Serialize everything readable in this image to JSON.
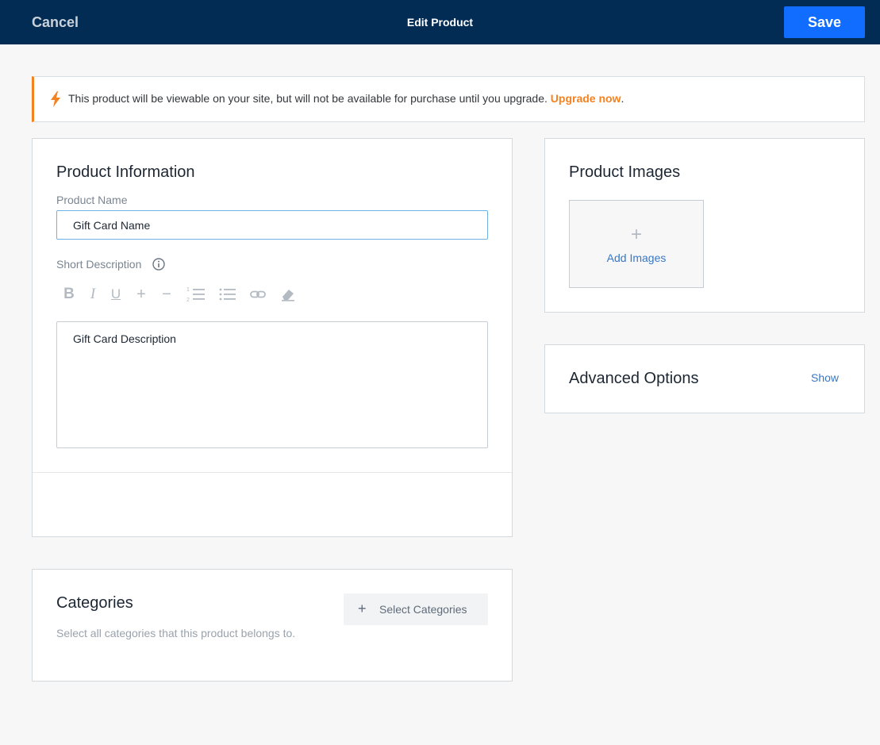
{
  "header": {
    "cancel_label": "Cancel",
    "title": "Edit Product",
    "save_label": "Save"
  },
  "banner": {
    "icon": "lightning-bolt-icon",
    "message": "This product will be viewable on your site, but will not be available for purchase until you upgrade. ",
    "link_label": "Upgrade now",
    "suffix": ".",
    "accent_color": "#f58220"
  },
  "product_info": {
    "title": "Product Information",
    "name_label": "Product Name",
    "name_value": "Gift Card Name",
    "description_label": "Short Description",
    "description_value": "Gift Card Description",
    "toolbar": [
      "bold-icon",
      "italic-icon",
      "underline-icon",
      "increase-font-icon",
      "decrease-font-icon",
      "numbered-list-icon",
      "bulleted-list-icon",
      "link-icon",
      "clear-formatting-icon"
    ]
  },
  "product_images": {
    "title": "Product Images",
    "add_label": "Add Images"
  },
  "advanced_options": {
    "title": "Advanced Options",
    "toggle_label": "Show"
  },
  "categories": {
    "title": "Categories",
    "subtitle": "Select all categories that this product belongs to.",
    "button_label": "Select Categories"
  },
  "colors": {
    "header_bg": "#032c54",
    "primary": "#116dff",
    "link": "#3778c6"
  }
}
